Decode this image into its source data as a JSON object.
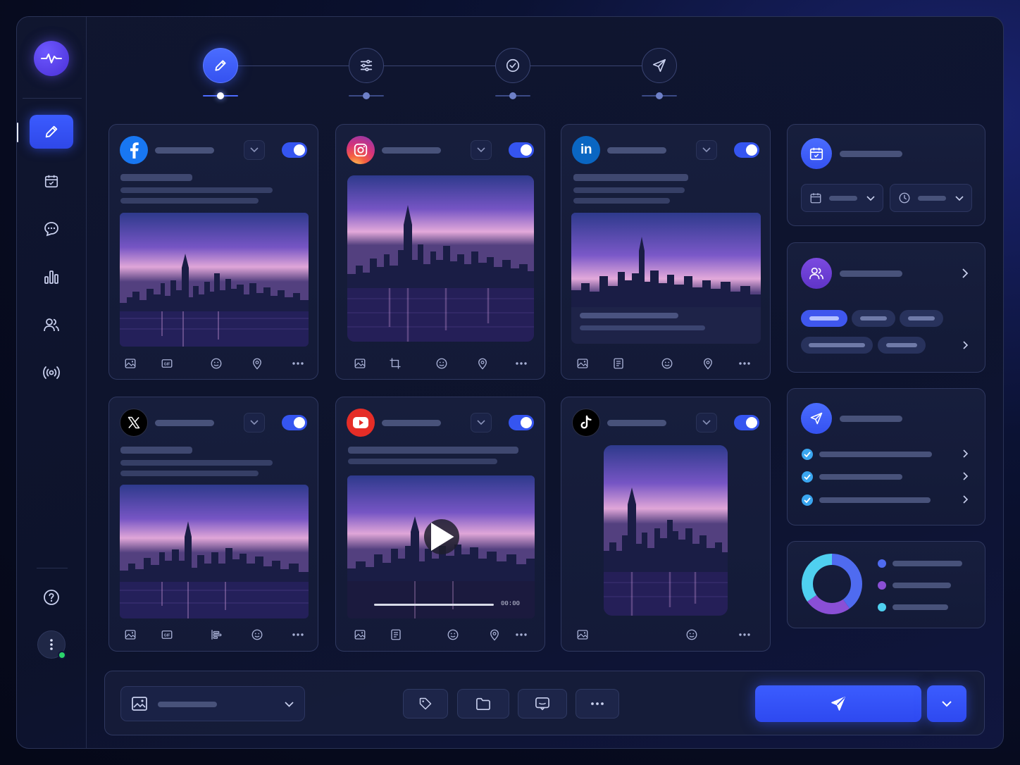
{
  "app": {
    "accent": "#3555f0",
    "background": "#0b1233",
    "logo_icon": "pulse-icon"
  },
  "sidebar": {
    "items": [
      {
        "id": "compose",
        "icon": "pencil-icon",
        "active": true
      },
      {
        "id": "calendar",
        "icon": "calendar-icon",
        "active": false
      },
      {
        "id": "messages",
        "icon": "chat-bubble-icon",
        "active": false
      },
      {
        "id": "analytics",
        "icon": "bar-chart-icon",
        "active": false
      },
      {
        "id": "audience",
        "icon": "users-icon",
        "active": false
      },
      {
        "id": "broadcast",
        "icon": "broadcast-icon",
        "active": false
      }
    ],
    "bottom": [
      {
        "id": "help",
        "icon": "help-icon"
      },
      {
        "id": "more",
        "icon": "more-vertical-icon",
        "status": "online",
        "status_color": "#2bd46a"
      }
    ]
  },
  "stepper": {
    "steps": [
      {
        "id": "compose",
        "icon": "pencil-icon",
        "active": true
      },
      {
        "id": "settings",
        "icon": "sliders-icon",
        "active": false
      },
      {
        "id": "review",
        "icon": "check-circle-icon",
        "active": false
      },
      {
        "id": "publish",
        "icon": "send-icon",
        "active": false
      }
    ]
  },
  "posts": [
    {
      "platform": "facebook",
      "icon": "facebook-icon",
      "color": "#1877f2",
      "enabled": true,
      "media": "image",
      "tools": [
        "image-icon",
        "gif-icon",
        "emoji-icon",
        "location-icon",
        "more-icon"
      ]
    },
    {
      "platform": "instagram",
      "icon": "instagram-icon",
      "color": "#d6337a",
      "enabled": true,
      "media": "image",
      "tools": [
        "image-icon",
        "crop-icon",
        "emoji-icon",
        "location-icon",
        "more-icon"
      ]
    },
    {
      "platform": "linkedin",
      "icon": "linkedin-icon",
      "color": "#0a66c2",
      "enabled": true,
      "media": "image",
      "tools": [
        "image-icon",
        "document-icon",
        "emoji-icon",
        "location-icon",
        "more-icon"
      ]
    },
    {
      "platform": "x",
      "icon": "x-logo-icon",
      "color": "#000000",
      "enabled": true,
      "media": "image",
      "tools": [
        "image-icon",
        "gif-icon",
        "poll-icon",
        "emoji-icon",
        "more-icon"
      ]
    },
    {
      "platform": "youtube",
      "icon": "youtube-icon",
      "color": "#e52d27",
      "enabled": true,
      "media": "video",
      "video_time": "00:00",
      "tools": [
        "image-icon",
        "document-icon",
        "emoji-icon",
        "location-icon",
        "more-icon"
      ]
    },
    {
      "platform": "tiktok",
      "icon": "tiktok-icon",
      "color": "#000000",
      "enabled": true,
      "media": "vertical-image",
      "tools": [
        "image-icon",
        "emoji-icon",
        "more-icon"
      ]
    }
  ],
  "schedule_panel": {
    "icon": "calendar-icon",
    "date_icon": "calendar-icon",
    "time_icon": "clock-icon"
  },
  "audience_panel": {
    "icon": "users-icon",
    "pills": 5,
    "active_pill": 0
  },
  "publish_panel": {
    "icon": "send-icon",
    "checks": 3
  },
  "stats_panel": {
    "chart_data": {
      "type": "pie",
      "values": [
        40,
        25,
        35
      ],
      "colors": [
        "#4f6bf0",
        "#8a4fd6",
        "#4fd0f0"
      ]
    }
  },
  "bottom_bar": {
    "media_icon": "image-gallery-icon",
    "actions": [
      "tag-icon",
      "folder-icon",
      "comment-icon",
      "more-icon"
    ],
    "publish_icon": "send-icon",
    "more_icon": "chevron-down-icon"
  }
}
